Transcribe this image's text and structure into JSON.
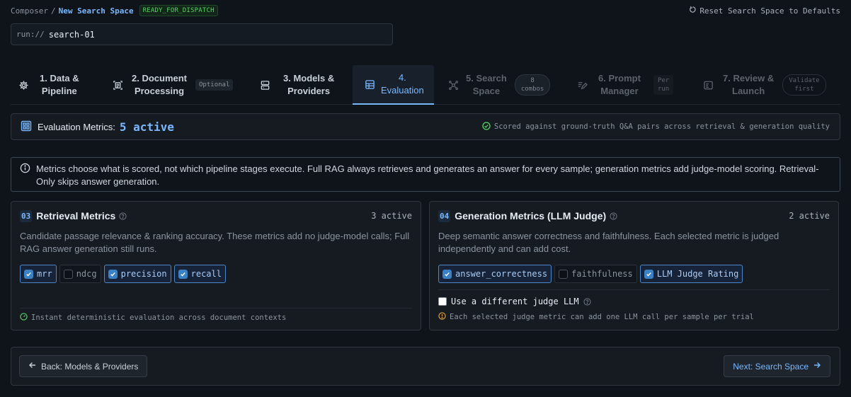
{
  "breadcrumb": {
    "root": "Composer",
    "separator": "/",
    "current": "New Search Space",
    "status": "READY_FOR_DISPATCH"
  },
  "reset_label": "Reset Search Space to Defaults",
  "run": {
    "prefix": "run://",
    "value": "search-01"
  },
  "steps": [
    {
      "line1": "1. Data &",
      "line2": "Pipeline",
      "icon": "gear-icon",
      "state": "done"
    },
    {
      "line1": "2. Document",
      "line2": "Processing",
      "tag": "Optional",
      "icon": "document-scan-icon",
      "state": "done"
    },
    {
      "line1": "3. Models &",
      "line2": "Providers",
      "icon": "server-icon",
      "state": "done"
    },
    {
      "line1": "4.",
      "line2": "Evaluation",
      "icon": "grid-icon",
      "state": "active"
    },
    {
      "line1": "5. Search",
      "line2": "Space",
      "pill1": "8",
      "pill2": "combos",
      "icon": "network-icon",
      "state": "disabled"
    },
    {
      "line1": "6. Prompt",
      "line2": "Manager",
      "pill1": "Per",
      "pill2": "run",
      "icon": "edit-icon",
      "state": "disabled"
    },
    {
      "line1": "7. Review &",
      "line2": "Launch",
      "pill1": "Validate",
      "pill2": "first",
      "icon": "review-icon",
      "state": "disabled"
    }
  ],
  "metrics_header": {
    "label": "Evaluation Metrics:",
    "count": "5 active",
    "note": "Scored against ground-truth Q&A pairs across retrieval & generation quality"
  },
  "info": "Metrics choose what is scored, not which pipeline stages execute. Full RAG always retrieves and generates an answer for every sample; generation metrics add judge-model scoring. Retrieval-Only skips answer generation.",
  "retrieval": {
    "num": "03",
    "title": "Retrieval Metrics",
    "active": "3 active",
    "description": "Candidate passage relevance & ranking accuracy. These metrics add no judge-model calls; Full RAG answer generation still runs.",
    "metrics": [
      {
        "name": "mrr",
        "checked": true
      },
      {
        "name": "ndcg",
        "checked": false
      },
      {
        "name": "precision",
        "checked": true
      },
      {
        "name": "recall",
        "checked": true
      }
    ],
    "footnote": "Instant deterministic evaluation across document contexts"
  },
  "generation": {
    "num": "04",
    "title": "Generation Metrics (LLM Judge)",
    "active": "2 active",
    "description": "Deep semantic answer correctness and faithfulness. Each selected metric is judged independently and can add cost.",
    "metrics": [
      {
        "name": "answer_correctness",
        "checked": true
      },
      {
        "name": "faithfulness",
        "checked": false
      },
      {
        "name": "LLM Judge Rating",
        "checked": true
      }
    ],
    "judge_option": "Use a different judge LLM",
    "footnote": "Each selected judge metric can add one LLM call per sample per trial"
  },
  "nav": {
    "back": "Back: Models & Providers",
    "next": "Next: Search Space"
  },
  "colors": {
    "accent": "#79b8ff",
    "success": "#56d364",
    "warning": "#e3a23a",
    "background": "#0f131a"
  }
}
